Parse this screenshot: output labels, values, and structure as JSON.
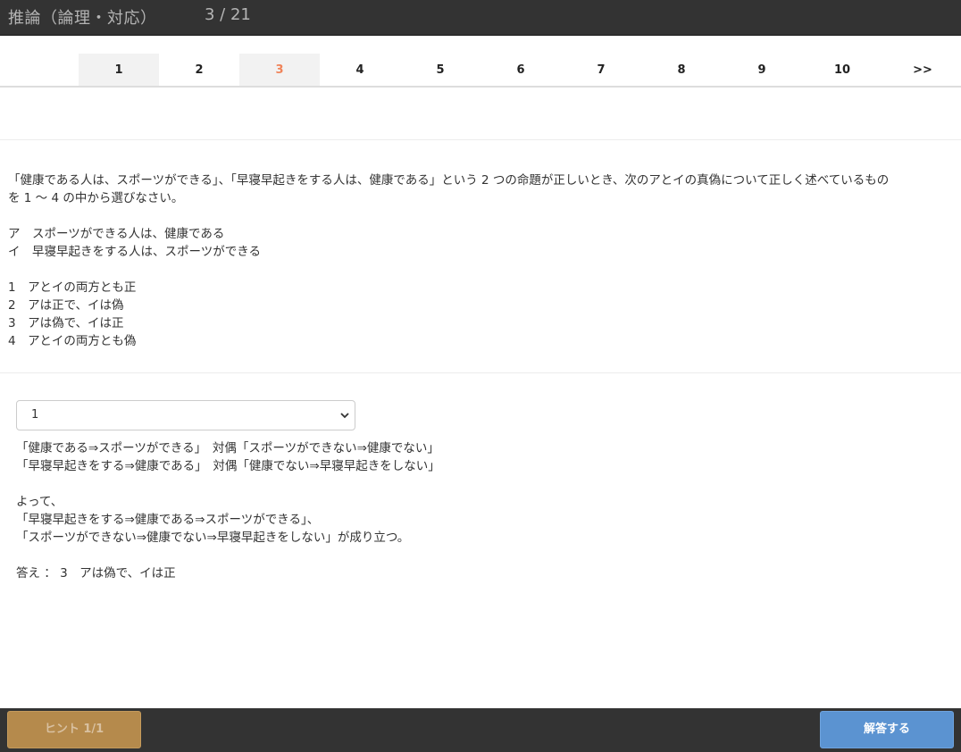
{
  "header": {
    "title": "推論（論理・対応）",
    "counter": "3 / 21"
  },
  "pager": {
    "pages": [
      "1",
      "2",
      "3",
      "4",
      "5",
      "6",
      "7",
      "8",
      "9",
      "10",
      ">>"
    ],
    "current": "3"
  },
  "question": {
    "stem_line1": "「健康である人は、スポーツができる」、「早寝早起きをする人は、健康である」という 2 つの命題が正しいとき、次のアとイの真偽について正しく述べているもの",
    "stem_line2": "を 1 ～ 4 の中から選びなさい。",
    "statement_a": "ア　スポーツができる人は、健康である",
    "statement_b": "イ　早寝早起きをする人は、スポーツができる",
    "choices": [
      "1　アとイの両方とも正",
      "2　アは正で、イは偽",
      "3　アは偽で、イは正",
      "4　アとイの両方とも偽"
    ]
  },
  "answer_select": {
    "selected": "1"
  },
  "explanation": {
    "line1": "「健康である⇒スポーツができる」　対偶「スポーツができない⇒健康でない」",
    "line2": "「早寝早起きをする⇒健康である」　対偶「健康でない⇒早寝早起きをしない」",
    "line3": "よって、",
    "line4": "「早寝早起きをする⇒健康である⇒スポーツができる」、",
    "line5": "「スポーツができない⇒健康でない⇒早寝早起きをしない」が成り立つ。",
    "line6": "答え ： 3　アは偽で、イは正"
  },
  "footer": {
    "hint_label": "ヒント 1/1",
    "submit_label": "解答する"
  },
  "colors": {
    "topbar": "#333333",
    "current_page": "#f0845a",
    "hint_button": "#b58a4c",
    "submit_button": "#5b93d1"
  }
}
